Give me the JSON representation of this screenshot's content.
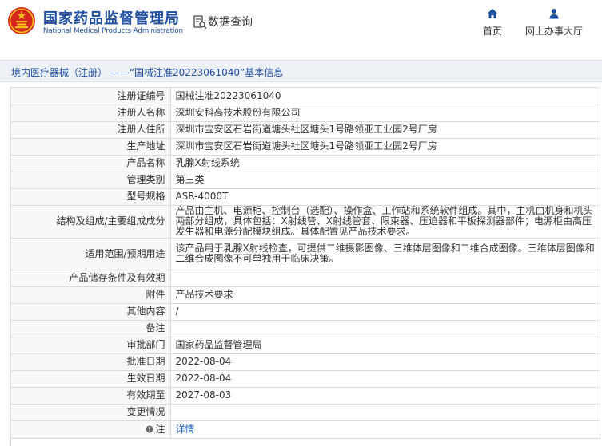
{
  "header": {
    "logo_cn": "国家药品监督管理局",
    "logo_en": "National Medical Products Administration",
    "database_label": "数据查询",
    "nav": [
      {
        "label": "首页",
        "icon": "home-icon"
      },
      {
        "label": "网上办事大厅",
        "icon": "user-icon"
      }
    ]
  },
  "title_bar": {
    "text": "境内医疗器械（注册） ——“国械注准20223061040”基本信息"
  },
  "details": {
    "rows": [
      {
        "label": "注册证编号",
        "value": "国械注准20223061040"
      },
      {
        "label": "注册人名称",
        "value": "深圳安科高技术股份有限公司"
      },
      {
        "label": "注册人住所",
        "value": "深圳市宝安区石岩街道塘头社区塘头1号路领亚工业园2号厂房"
      },
      {
        "label": "生产地址",
        "value": "深圳市宝安区石岩街道塘头社区塘头1号路领亚工业园2号厂房"
      },
      {
        "label": "产品名称",
        "value": "乳腺X射线系统"
      },
      {
        "label": "管理类别",
        "value": "第三类"
      },
      {
        "label": "型号规格",
        "value": "ASR-4000T"
      },
      {
        "label": "结构及组成/主要组成成分",
        "value": "产品由主机、电源柜、控制台（选配）、操作盒、工作站和系统软件组成。其中，主机由机身和机头两部分组成，具体包括：X射线管、X射线管套、限束器、压迫器和平板探测器部件；电源柜由高压发生器和电源分配模块组成。具体配置见产品技术要求。"
      },
      {
        "label": "适用范围/预期用途",
        "value": "该产品用于乳腺X射线检查，可提供二维摄影图像、三维体层图像和二维合成图像。三维体层图像和二维合成图像不可单独用于临床决策。"
      },
      {
        "label": "产品储存条件及有效期",
        "value": ""
      },
      {
        "label": "附件",
        "value": "产品技术要求"
      },
      {
        "label": "其他内容",
        "value": "/"
      },
      {
        "label": "备注",
        "value": ""
      },
      {
        "label": "审批部门",
        "value": "国家药品监督管理局"
      },
      {
        "label": "批准日期",
        "value": "2022-08-04"
      },
      {
        "label": "生效日期",
        "value": "2022-08-04"
      },
      {
        "label": "有效期至",
        "value": "2027-08-03"
      },
      {
        "label": "变更情况",
        "value": ""
      },
      {
        "label": "注",
        "value": "详情",
        "icon": "note-icon"
      }
    ]
  },
  "colors": {
    "brand_blue": "#1f4fa3",
    "emblem_red": "#d7261e",
    "emblem_gold": "#f3c21a",
    "link_blue": "#1f5fbf"
  }
}
